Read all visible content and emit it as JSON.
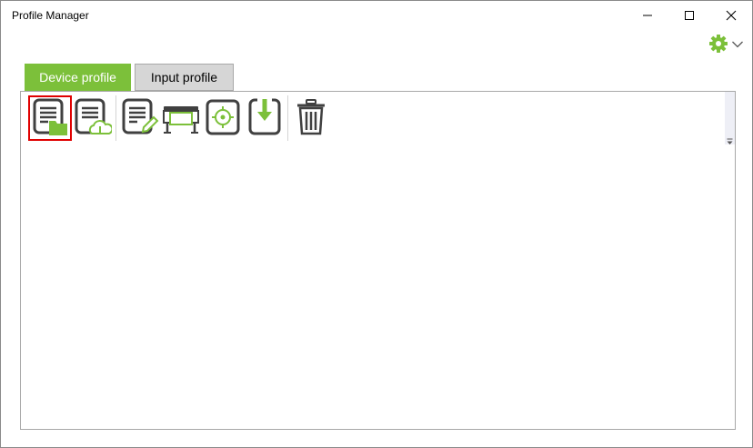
{
  "window": {
    "title": "Profile Manager"
  },
  "title_buttons": [
    {
      "name": "minimize-button",
      "icon": "minimize-icon"
    },
    {
      "name": "maximize-button",
      "icon": "maximize-icon"
    },
    {
      "name": "close-button",
      "icon": "close-icon"
    }
  ],
  "settings_menu": {
    "icon": "gear-icon",
    "dropdown_icon": "chevron-down-icon"
  },
  "tabs": [
    {
      "label": "Device profile",
      "active": true
    },
    {
      "label": "Input profile",
      "active": false
    }
  ],
  "toolbar": {
    "buttons": [
      {
        "icon": "open-profile-folder-icon",
        "selected": true
      },
      {
        "icon": "download-profile-cloud-icon"
      },
      {
        "icon": "edit-profile-icon"
      },
      {
        "icon": "printer-icon"
      },
      {
        "icon": "target-calibration-icon"
      },
      {
        "icon": "import-profile-icon"
      },
      {
        "icon": "trash-icon"
      }
    ],
    "overflow_icon": "overflow-arrow-icon"
  },
  "colors": {
    "accent_green": "#7cc03a",
    "icon_gray": "#404040",
    "tab_inactive_bg": "#d6d6d6",
    "selection_red": "#e00000",
    "panel_border": "#a8a8a8"
  }
}
